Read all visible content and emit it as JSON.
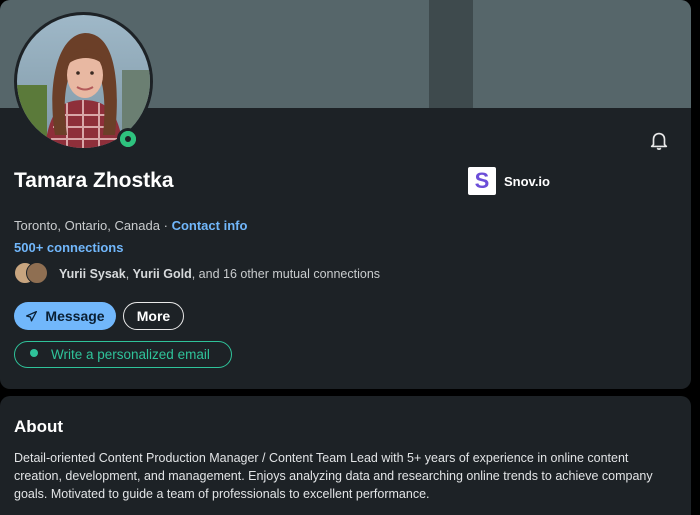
{
  "profile": {
    "name": "Tamara Zhostka",
    "location": "Toronto, Ontario, Canada",
    "separator": "·",
    "contact_info": "Contact info",
    "connections": "500+ connections",
    "mutual": {
      "name1": "Yurii Sysak",
      "comma": ", ",
      "name2": "Yurii Gold",
      "rest": ", and 16 other mutual connections"
    },
    "status": "online"
  },
  "company": {
    "logo_letter": "S",
    "name": "Snov.io"
  },
  "actions": {
    "message": "Message",
    "more": "More",
    "email": "Write a personalized email"
  },
  "about": {
    "title": "About",
    "text": "Detail-oriented Content Production Manager / Content Team Lead with 5+ years of experience in online content creation, development, and management. Enjoys analyzing data and researching online trends to achieve company goals. Motivated to guide a team of professionals to excellent performance."
  },
  "colors": {
    "link": "#71b7fb",
    "online": "#2ec27e",
    "email_accent": "#2fc39a",
    "card_bg": "#1d2226"
  },
  "icons": {
    "bell": "bell-icon",
    "send": "send-icon",
    "logo": "snov-logo"
  }
}
